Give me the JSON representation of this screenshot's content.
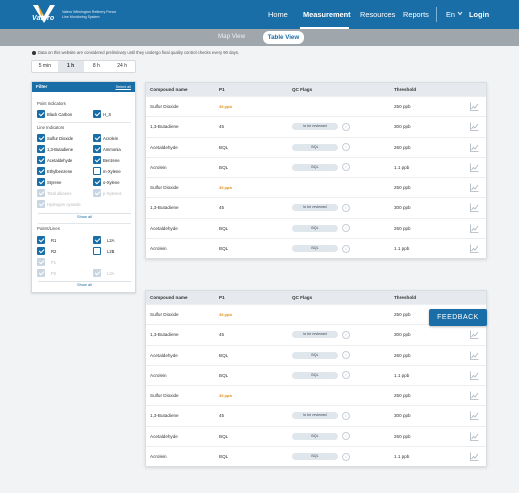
{
  "brand": {
    "logo_text": "Valero",
    "tagline": "Valero Wilmington Refinery Fence Line Monitoring System"
  },
  "nav": {
    "home": "Home",
    "measurement": "Measurement",
    "resources": "Resources",
    "reports": "Reports",
    "language": "En",
    "login": "Login"
  },
  "view_toggle": {
    "map": "Map View",
    "table": "Table View",
    "active": "Table View"
  },
  "disclaimer": "Data on this website are considered preliminary until they undergo final quality control checks every 90 days.",
  "time_buttons": [
    "5 min",
    "1 h",
    "8 h",
    "24 h"
  ],
  "time_selected": "1 h",
  "filter": {
    "title": "Filter",
    "select_all": "Select all",
    "point_indicators_title": "Point Indicators",
    "point_indicators": [
      {
        "label": "Black Carbon",
        "checked": true
      },
      {
        "label": "H_S",
        "checked": true
      }
    ],
    "line_indicators_title": "Line Indicators",
    "line_indicators": [
      {
        "label": "Sulfur Dioxide",
        "checked": true
      },
      {
        "label": "Acrolein",
        "checked": true
      },
      {
        "label": "1,3-Butadiene",
        "checked": true
      },
      {
        "label": "Ammonia",
        "checked": true
      },
      {
        "label": "Acetaldehyde",
        "checked": true
      },
      {
        "label": "Benzene",
        "checked": true
      },
      {
        "label": "Ethylbenzene",
        "checked": true
      },
      {
        "label": "m-Xylene",
        "checked": false
      },
      {
        "label": "Styrene",
        "checked": true
      },
      {
        "label": "o-Xylene",
        "checked": true
      },
      {
        "label": "Total alkanes",
        "checked": true,
        "disabled": true
      },
      {
        "label": "p-Xylenes",
        "checked": true,
        "disabled": true
      },
      {
        "label": "Hydrogen cyanide",
        "checked": true,
        "disabled": true
      }
    ],
    "show_all": "Show all",
    "points_lines_title": "Points/Lines",
    "points_lines": [
      {
        "label": "R1",
        "checked": true
      },
      {
        "label": "L2A",
        "checked": true
      },
      {
        "label": "R2",
        "checked": true
      },
      {
        "label": "L2B",
        "checked": false
      },
      {
        "label": "P1",
        "checked": true,
        "disabled": true
      },
      {
        "label": "P2",
        "checked": true,
        "disabled": true
      },
      {
        "label": "L3A",
        "checked": true,
        "disabled": true
      }
    ],
    "show_all_2": "Show all"
  },
  "tables": [
    {
      "headers": [
        "Compound name",
        "P1",
        "QC Flags",
        "Threshold"
      ],
      "rows": [
        {
          "compound": "Sulfur Dioxide",
          "p1": "39 ppb",
          "p1_warn": true,
          "qc": "",
          "threshold": "250 ppb"
        },
        {
          "compound": "1,3-Butadiene",
          "p1": "45",
          "p1_warn": false,
          "qc": "to be reviewed",
          "threshold": "300 ppb"
        },
        {
          "compound": "Acetaldehyde",
          "p1": "BQL",
          "p1_warn": false,
          "qc": "BQL",
          "threshold": "260 ppb"
        },
        {
          "compound": "Acrolein",
          "p1": "BQL",
          "p1_warn": false,
          "qc": "BQL",
          "threshold": "1.1 ppb"
        },
        {
          "compound": "Sulfur Dioxide",
          "p1": "39 ppb",
          "p1_warn": true,
          "qc": "",
          "threshold": "250 ppb"
        },
        {
          "compound": "1,3-Butadiene",
          "p1": "45",
          "p1_warn": false,
          "qc": "to be reviewed",
          "threshold": "300 ppb"
        },
        {
          "compound": "Acetaldehyde",
          "p1": "BQL",
          "p1_warn": false,
          "qc": "BQL",
          "threshold": "260 ppb"
        },
        {
          "compound": "Acrolein",
          "p1": "BQL",
          "p1_warn": false,
          "qc": "BQL",
          "threshold": "1.1 ppb"
        }
      ]
    },
    {
      "headers": [
        "Compound name",
        "P1",
        "QC Flags",
        "Threshold"
      ],
      "rows": [
        {
          "compound": "Sulfur Dioxide",
          "p1": "39 ppb",
          "p1_warn": true,
          "qc": "",
          "threshold": "250 ppb"
        },
        {
          "compound": "1,3-Butadiene",
          "p1": "45",
          "p1_warn": false,
          "qc": "to be reviewed",
          "threshold": "300 ppb"
        },
        {
          "compound": "Acetaldehyde",
          "p1": "BQL",
          "p1_warn": false,
          "qc": "BQL",
          "threshold": "260 ppb"
        },
        {
          "compound": "Acrolein",
          "p1": "BQL",
          "p1_warn": false,
          "qc": "BQL",
          "threshold": "1.1 ppb"
        },
        {
          "compound": "Sulfur Dioxide",
          "p1": "39 ppb",
          "p1_warn": true,
          "qc": "",
          "threshold": "250 ppb"
        },
        {
          "compound": "1,3-Butadiene",
          "p1": "45",
          "p1_warn": false,
          "qc": "to be reviewed",
          "threshold": "300 ppb"
        },
        {
          "compound": "Acetaldehyde",
          "p1": "BQL",
          "p1_warn": false,
          "qc": "BQL",
          "threshold": "260 ppb"
        },
        {
          "compound": "Acrolein",
          "p1": "BQL",
          "p1_warn": false,
          "qc": "BQL",
          "threshold": "1.1 ppb"
        }
      ]
    }
  ],
  "feedback": "FEEDBACK",
  "colors": {
    "brand": "#1a6ea8",
    "warning": "#e0911b",
    "viewbar": "#9fa6ac"
  }
}
